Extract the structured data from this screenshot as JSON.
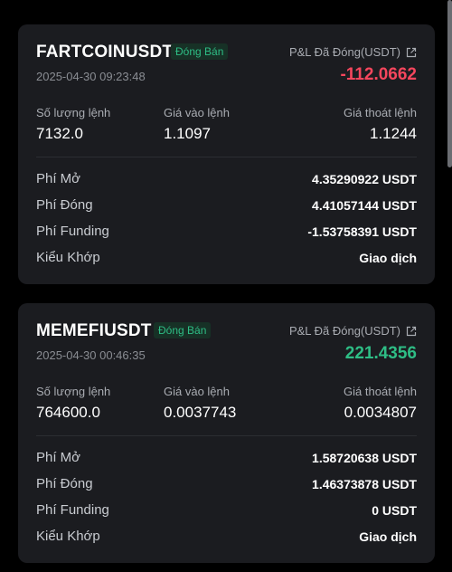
{
  "positions": [
    {
      "symbol": "FARTCOINUSDT",
      "badge": "Đóng Bán",
      "datetime": "2025-04-30 09:23:48",
      "pnl_label": "P&L Đã Đóng(USDT)",
      "pnl_value": "-112.0662",
      "qty_label": "Số lượng lệnh",
      "qty_value": "7132.0",
      "entry_label": "Giá vào lệnh",
      "entry_value": "1.1097",
      "exit_label": "Giá thoát lệnh",
      "exit_value": "1.1244",
      "fees": [
        {
          "label": "Phí Mở",
          "value": "4.35290922 USDT"
        },
        {
          "label": "Phí Đóng",
          "value": "4.41057144 USDT"
        },
        {
          "label": "Phí Funding",
          "value": "-1.53758391 USDT"
        },
        {
          "label": "Kiểu Khớp",
          "value": "Giao dịch"
        }
      ]
    },
    {
      "symbol": "MEMEFIUSDT",
      "badge": "Đóng Bán",
      "datetime": "2025-04-30 00:46:35",
      "pnl_label": "P&L Đã Đóng(USDT)",
      "pnl_value": "221.4356",
      "qty_label": "Số lượng lệnh",
      "qty_value": "764600.0",
      "entry_label": "Giá vào lệnh",
      "entry_value": "0.0037743",
      "exit_label": "Giá thoát lệnh",
      "exit_value": "0.0034807",
      "fees": [
        {
          "label": "Phí Mở",
          "value": "1.58720638 USDT"
        },
        {
          "label": "Phí Đóng",
          "value": "1.46373878 USDT"
        },
        {
          "label": "Phí Funding",
          "value": "0 USDT"
        },
        {
          "label": "Kiểu Khớp",
          "value": "Giao dịch"
        }
      ]
    }
  ],
  "colors": {
    "loss": "#f6465d",
    "profit": "#2ebd85",
    "card_bg": "#1b1c20"
  },
  "icons": {
    "pnl_link": "external-link-icon"
  }
}
